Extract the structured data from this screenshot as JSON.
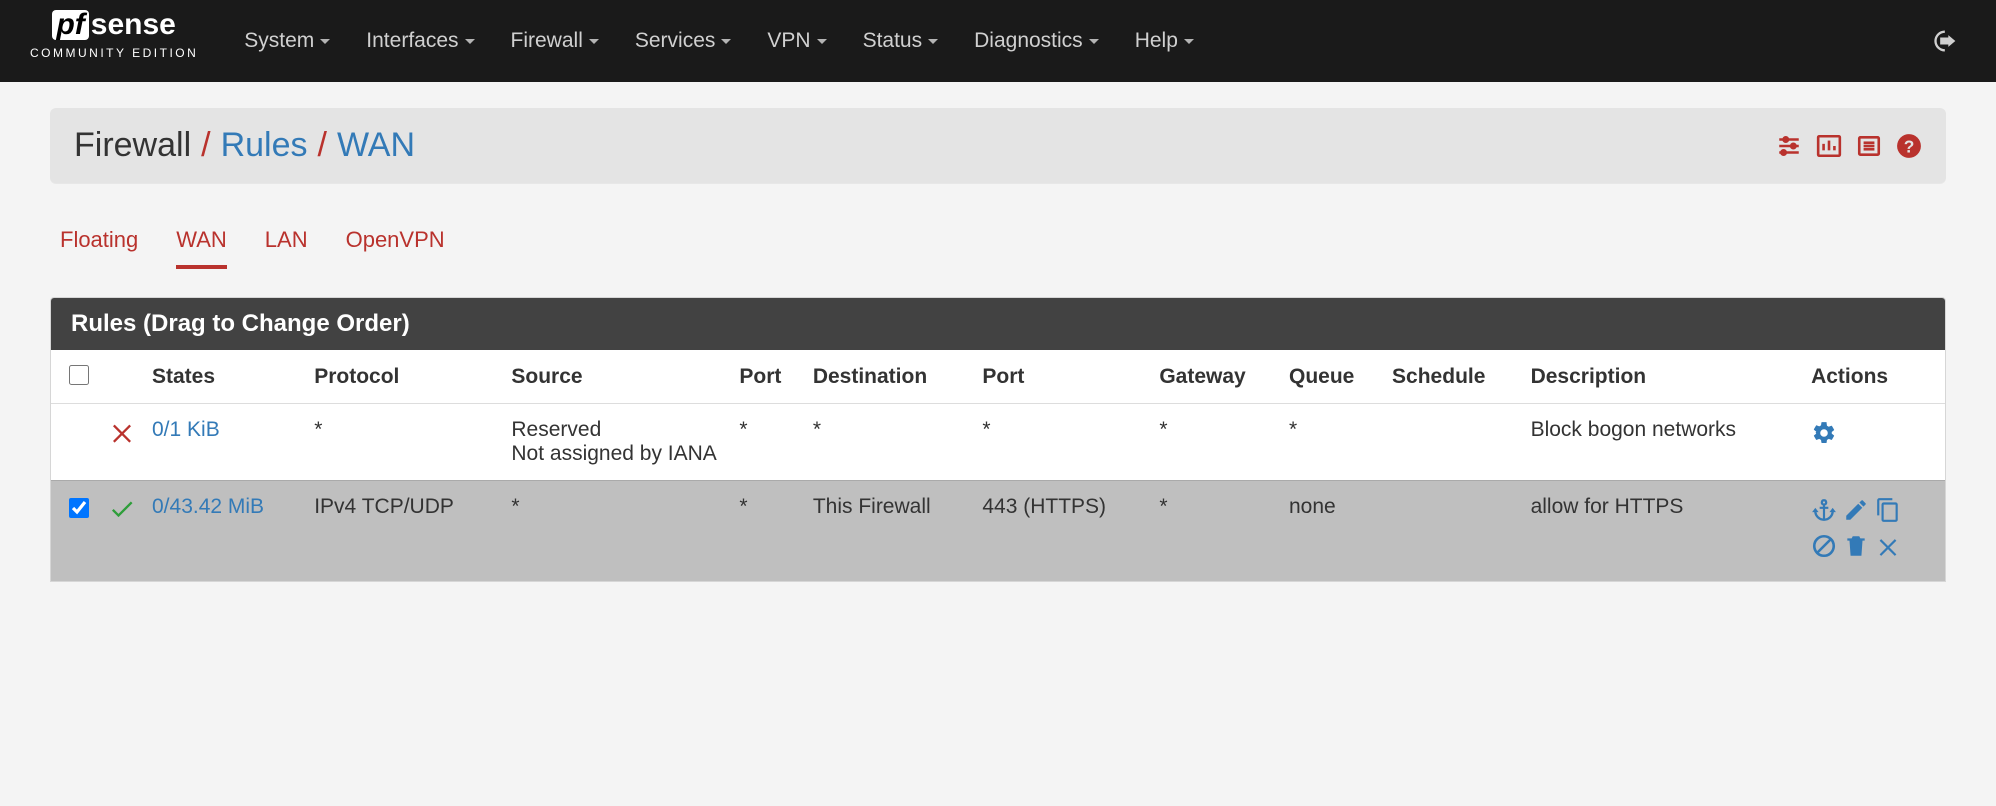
{
  "brand": {
    "pf": "pf",
    "sense": "sense",
    "ce": "COMMUNITY EDITION"
  },
  "nav": {
    "items": [
      "System",
      "Interfaces",
      "Firewall",
      "Services",
      "VPN",
      "Status",
      "Diagnostics",
      "Help"
    ]
  },
  "breadcrumb": {
    "root": "Firewall",
    "mid": "Rules",
    "leaf": "WAN",
    "sep": "/"
  },
  "tabs": [
    "Floating",
    "WAN",
    "LAN",
    "OpenVPN"
  ],
  "active_tab": "WAN",
  "panel_title": "Rules (Drag to Change Order)",
  "columns": [
    "",
    "",
    "States",
    "Protocol",
    "Source",
    "Port",
    "Destination",
    "Port",
    "Gateway",
    "Queue",
    "Schedule",
    "Description",
    "Actions"
  ],
  "rows": [
    {
      "selected": false,
      "status_icon": "block",
      "states": "0/1 KiB",
      "protocol": "*",
      "source": "Reserved\nNot assigned by IANA",
      "sport": "*",
      "destination": "*",
      "dport": "*",
      "gateway": "*",
      "queue": "*",
      "schedule": "",
      "description": "Block bogon networks",
      "actions_set": "gear"
    },
    {
      "selected": true,
      "status_icon": "pass",
      "states": "0/43.42 MiB",
      "protocol": "IPv4 TCP/UDP",
      "source": "*",
      "sport": "*",
      "destination": "This Firewall",
      "dport": "443 (HTTPS)",
      "gateway": "*",
      "queue": "none",
      "schedule": "",
      "description": "allow for HTTPS",
      "actions_set": "full"
    }
  ]
}
